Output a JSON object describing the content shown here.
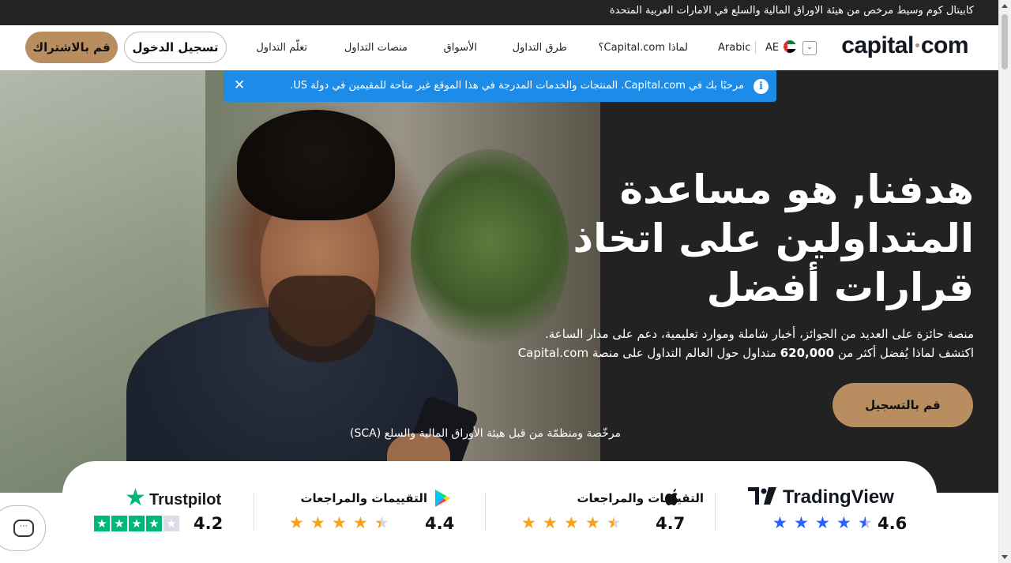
{
  "top_bar": {
    "text": "كابيتال كوم وسيط مرخص من هيئة الاوراق المالية والسلع في الامارات العربية المتحدة"
  },
  "header": {
    "logo": {
      "part1": "capital",
      "part2": "com"
    },
    "country_code": "AE",
    "language": "Arabic",
    "nav": [
      "لماذا Capital.com؟",
      "طرق التداول",
      "الأسواق",
      "منصات التداول",
      "تعلّم التداول"
    ],
    "login_label": "تسجيل الدخول",
    "signup_label": "قم بالاشتراك"
  },
  "banner": {
    "info_glyph": "i",
    "text": "مرحبًا بك في Capital.com. المنتجات والخدمات المدرجة في هذا الموقع غير متاحة للمقيمين في دولة US.",
    "close_glyph": "✕"
  },
  "hero": {
    "title_line1": "هدفنا, هو مساعدة",
    "title_line2": "المتداولين على اتخاذ",
    "title_line3": "قرارات أفضل",
    "subtitle_line1": "منصة حائزة على العديد من الجوائز، أخبار شاملة وموارد تعليمية، دعم على مدار الساعة.",
    "subtitle_line2_pre": "اكتشف لماذا يُفضل أكثر من ",
    "subtitle_line2_num": "620,000",
    "subtitle_line2_post": " متداول حول العالم التداول على منصة Capital.com",
    "register_label": "قم بالتسجيل",
    "regulated_text": "مرخّصة ومنظمّة من قبل هيئة الأوراق المالية والسلع (SCA)"
  },
  "ratings": {
    "tradingview": {
      "brand": "TradingView",
      "score": "4.6"
    },
    "apple": {
      "title": "التقييمات والمراجعات",
      "score": "4.7"
    },
    "google_play": {
      "title": "التقييمات والمراجعات",
      "score": "4.4"
    },
    "trustpilot": {
      "brand": "Trustpilot",
      "score": "4.2"
    }
  },
  "colors": {
    "accent": "#b88d5f",
    "banner": "#1c8ce8",
    "tradingview_star": "#2962ff",
    "store_star": "#f7a21b",
    "trustpilot_green": "#00b67a"
  },
  "icons": {
    "info": "info-icon",
    "close": "close-icon",
    "apple": "apple-icon",
    "google_play": "google-play-icon",
    "trustpilot_star": "trustpilot-star-icon",
    "chat": "chat-icon",
    "chevron": "chevron-down-icon",
    "flag": "uae-flag-icon"
  }
}
